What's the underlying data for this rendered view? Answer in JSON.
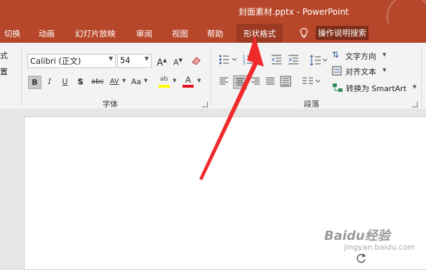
{
  "titlebar": {
    "title": "封面素材.pptx  -  PowerPoint"
  },
  "tabs": {
    "switch": "切换",
    "animation": "动画",
    "slideshow": "幻灯片放映",
    "review": "审阅",
    "view": "视图",
    "help": "帮助",
    "shape_format": "形状格式",
    "tell_me": "操作说明搜索"
  },
  "ribbon": {
    "font_name": "Calibri (正文)",
    "font_size": "54",
    "grow_font": "A",
    "shrink_font": "A",
    "bold": "B",
    "italic": "I",
    "underline": "U",
    "shadow": "S",
    "strikethrough": "abc",
    "spacing": "AV",
    "change_case": "Aa",
    "font_color_letter": "A",
    "font_group_label": "字体",
    "text_direction": "文字方向",
    "align_text": "对齐文本",
    "convert_smartart": "转换为 SmartArt",
    "paragraph_group_label": "段落",
    "left_partial_1": "式",
    "left_partial_2": "置"
  },
  "watermark": {
    "name": "Baidu经验",
    "sub": "jingyan.baidu.com"
  },
  "colors": {
    "accent": "#b7472a",
    "arrow": "#ee2a2a",
    "highlight": "#ffff00",
    "font_color": "#e81123"
  }
}
